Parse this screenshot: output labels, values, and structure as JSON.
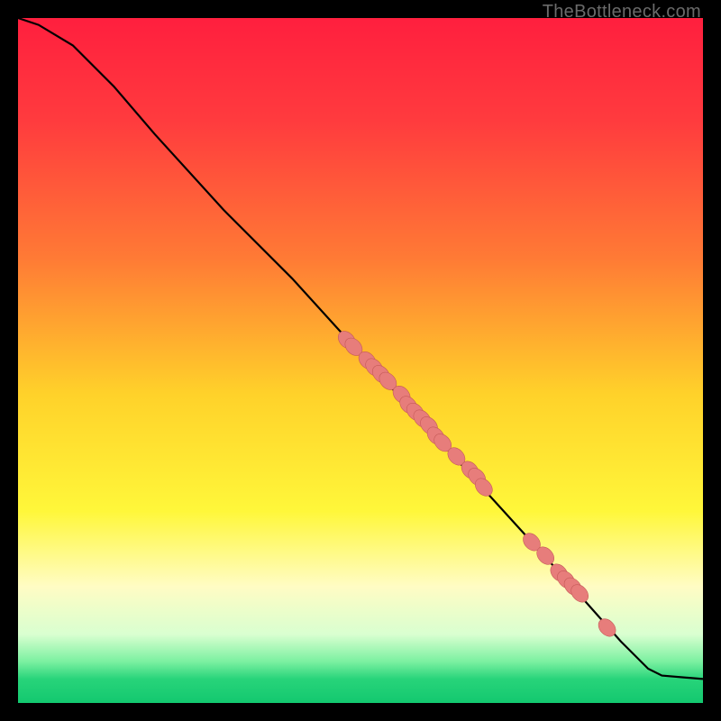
{
  "watermark": {
    "text": "TheBottleneck.com"
  },
  "colors": {
    "point_fill": "#e77d7b",
    "point_stroke": "#c55a58",
    "curve": "#000000",
    "bg": "#000000"
  },
  "chart_data": {
    "type": "line",
    "title": "",
    "xlabel": "",
    "ylabel": "",
    "xlim": [
      0,
      100
    ],
    "ylim": [
      0,
      100
    ],
    "gradient_stops": [
      {
        "offset": 0.0,
        "color": "#ff1f3e"
      },
      {
        "offset": 0.15,
        "color": "#ff3b3e"
      },
      {
        "offset": 0.35,
        "color": "#ff7a35"
      },
      {
        "offset": 0.55,
        "color": "#ffd22a"
      },
      {
        "offset": 0.72,
        "color": "#fff73a"
      },
      {
        "offset": 0.83,
        "color": "#fffcc4"
      },
      {
        "offset": 0.9,
        "color": "#d9ffd0"
      },
      {
        "offset": 0.94,
        "color": "#7af0a0"
      },
      {
        "offset": 0.965,
        "color": "#28d47a"
      },
      {
        "offset": 1.0,
        "color": "#13c86f"
      }
    ],
    "curve_points": [
      {
        "x": 0,
        "y": 100
      },
      {
        "x": 3,
        "y": 99
      },
      {
        "x": 8,
        "y": 96
      },
      {
        "x": 14,
        "y": 90
      },
      {
        "x": 20,
        "y": 83
      },
      {
        "x": 30,
        "y": 72
      },
      {
        "x": 40,
        "y": 62
      },
      {
        "x": 50,
        "y": 51
      },
      {
        "x": 60,
        "y": 40
      },
      {
        "x": 70,
        "y": 29
      },
      {
        "x": 80,
        "y": 18
      },
      {
        "x": 88,
        "y": 9
      },
      {
        "x": 92,
        "y": 5
      },
      {
        "x": 94,
        "y": 4
      },
      {
        "x": 100,
        "y": 3.5
      }
    ],
    "series": [
      {
        "name": "scatter-points",
        "points": [
          {
            "x": 48,
            "y": 53
          },
          {
            "x": 49,
            "y": 52
          },
          {
            "x": 51,
            "y": 50
          },
          {
            "x": 52,
            "y": 49
          },
          {
            "x": 53,
            "y": 48
          },
          {
            "x": 54,
            "y": 47
          },
          {
            "x": 56,
            "y": 45
          },
          {
            "x": 57,
            "y": 43.5
          },
          {
            "x": 58,
            "y": 42.5
          },
          {
            "x": 59,
            "y": 41.5
          },
          {
            "x": 60,
            "y": 40.5
          },
          {
            "x": 61,
            "y": 39
          },
          {
            "x": 62,
            "y": 38
          },
          {
            "x": 64,
            "y": 36
          },
          {
            "x": 66,
            "y": 34
          },
          {
            "x": 67,
            "y": 33
          },
          {
            "x": 68,
            "y": 31.5
          },
          {
            "x": 75,
            "y": 23.5
          },
          {
            "x": 77,
            "y": 21.5
          },
          {
            "x": 79,
            "y": 19
          },
          {
            "x": 80,
            "y": 18
          },
          {
            "x": 81,
            "y": 17
          },
          {
            "x": 82,
            "y": 16
          },
          {
            "x": 86,
            "y": 11
          }
        ]
      }
    ]
  }
}
